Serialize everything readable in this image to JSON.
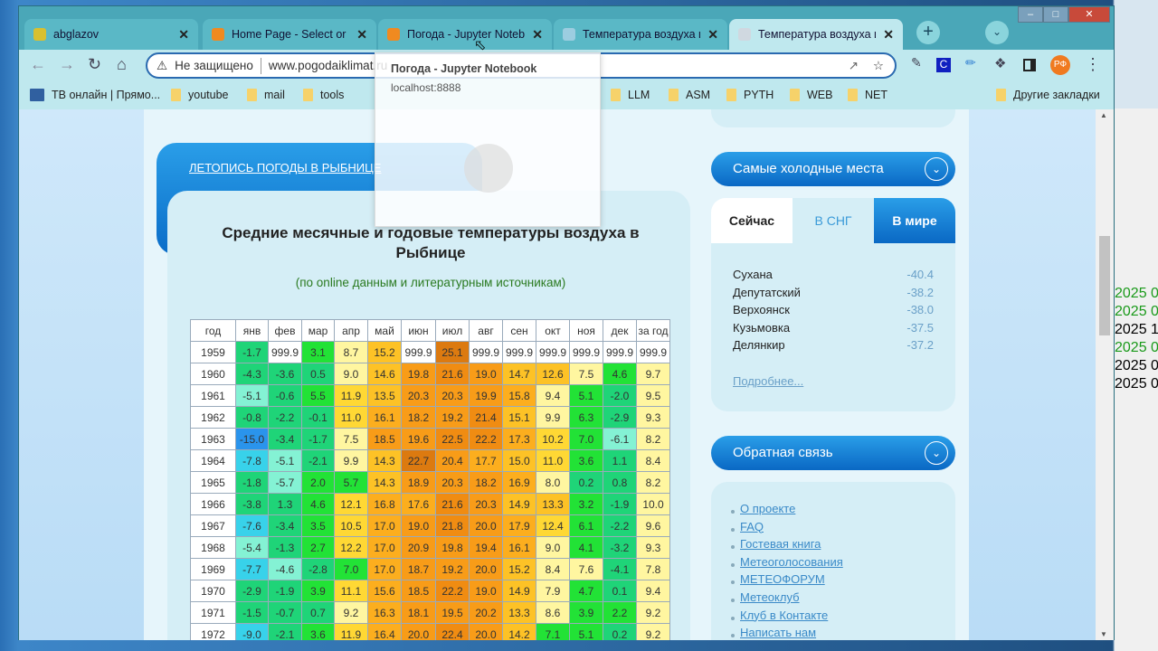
{
  "browser": {
    "tabs": [
      {
        "title": "abglazov",
        "favicon": "#d8c030",
        "active": false
      },
      {
        "title": "Home Page - Select or c",
        "favicon": "#f08a20",
        "active": false
      },
      {
        "title": "Погода - Jupyter Notebo",
        "favicon": "#f08a20",
        "active": false
      },
      {
        "title": "Температура воздуха и",
        "favicon": "#9ccde0",
        "active": false
      },
      {
        "title": "Температура воздуха и",
        "favicon": "#d0d8e0",
        "active": true
      }
    ],
    "security": "Не защищено",
    "url": "www.pogodaiklimat.ru",
    "profile": "РФ",
    "bookmarks": [
      "ТВ онлайн | Прямо...",
      "youtube",
      "mail",
      "tools",
      "LLM",
      "ASM",
      "PYTH",
      "WEB",
      "NET"
    ],
    "other_bookmarks": "Другие закладки",
    "tooltip": {
      "title": "Погода - Jupyter Notebook",
      "host": "localhost:8888"
    }
  },
  "page": {
    "header_link": "ЛЕТОПИСЬ ПОГОДЫ В РЫБНИЦЕ",
    "title": "Средние месячные и годовые температуры воздуха в Рыбнице",
    "subtitle": "(по online данным и литературным источникам)",
    "table": {
      "headers": [
        "год",
        "янв",
        "фев",
        "мар",
        "апр",
        "май",
        "июн",
        "июл",
        "авг",
        "сен",
        "окт",
        "ноя",
        "дек",
        "за год"
      ],
      "rows": [
        [
          "1959",
          "-1.7",
          "999.9",
          "3.1",
          "8.7",
          "15.2",
          "999.9",
          "25.1",
          "999.9",
          "999.9",
          "999.9",
          "999.9",
          "999.9",
          "999.9"
        ],
        [
          "1960",
          "-4.3",
          "-3.6",
          "0.5",
          "9.0",
          "14.6",
          "19.8",
          "21.6",
          "19.0",
          "14.7",
          "12.6",
          "7.5",
          "4.6",
          "9.7"
        ],
        [
          "1961",
          "-5.1",
          "-0.6",
          "5.5",
          "11.9",
          "13.5",
          "20.3",
          "20.3",
          "19.9",
          "15.8",
          "9.4",
          "5.1",
          "-2.0",
          "9.5"
        ],
        [
          "1962",
          "-0.8",
          "-2.2",
          "-0.1",
          "11.0",
          "16.1",
          "18.2",
          "19.2",
          "21.4",
          "15.1",
          "9.9",
          "6.3",
          "-2.9",
          "9.3"
        ],
        [
          "1963",
          "-15.0",
          "-3.4",
          "-1.7",
          "7.5",
          "18.5",
          "19.6",
          "22.5",
          "22.2",
          "17.3",
          "10.2",
          "7.0",
          "-6.1",
          "8.2"
        ],
        [
          "1964",
          "-7.8",
          "-5.1",
          "-2.1",
          "9.9",
          "14.3",
          "22.7",
          "20.4",
          "17.7",
          "15.0",
          "11.0",
          "3.6",
          "1.1",
          "8.4"
        ],
        [
          "1965",
          "-1.8",
          "-5.7",
          "2.0",
          "5.7",
          "14.3",
          "18.9",
          "20.3",
          "18.2",
          "16.9",
          "8.0",
          "0.2",
          "0.8",
          "8.2"
        ],
        [
          "1966",
          "-3.8",
          "1.3",
          "4.6",
          "12.1",
          "16.8",
          "17.6",
          "21.6",
          "20.3",
          "14.9",
          "13.3",
          "3.2",
          "-1.9",
          "10.0"
        ],
        [
          "1967",
          "-7.6",
          "-3.4",
          "3.5",
          "10.5",
          "17.0",
          "19.0",
          "21.8",
          "20.0",
          "17.9",
          "12.4",
          "6.1",
          "-2.2",
          "9.6"
        ],
        [
          "1968",
          "-5.4",
          "-1.3",
          "2.7",
          "12.2",
          "17.0",
          "20.9",
          "19.8",
          "19.4",
          "16.1",
          "9.0",
          "4.1",
          "-3.2",
          "9.3"
        ],
        [
          "1969",
          "-7.7",
          "-4.6",
          "-2.8",
          "7.0",
          "17.0",
          "18.7",
          "19.2",
          "20.0",
          "15.2",
          "8.4",
          "7.6",
          "-4.1",
          "7.8"
        ],
        [
          "1970",
          "-2.9",
          "-1.9",
          "3.9",
          "11.1",
          "15.6",
          "18.5",
          "22.2",
          "19.0",
          "14.9",
          "7.9",
          "4.7",
          "0.1",
          "9.4"
        ],
        [
          "1971",
          "-1.5",
          "-0.7",
          "0.7",
          "9.2",
          "16.3",
          "18.1",
          "19.5",
          "20.2",
          "13.3",
          "8.6",
          "3.9",
          "2.2",
          "9.2"
        ],
        [
          "1972",
          "-9.0",
          "-2.1",
          "3.6",
          "11.9",
          "16.4",
          "20.0",
          "22.4",
          "20.0",
          "14.2",
          "7.1",
          "5.1",
          "0.2",
          "9.2"
        ]
      ]
    }
  },
  "sidebar": {
    "cold_title": "Самые холодные места",
    "cold_tabs": [
      "Сейчас",
      "В СНГ",
      "В мире"
    ],
    "cold_places": [
      {
        "name": "Сухана",
        "temp": "-40.4"
      },
      {
        "name": "Депутатский",
        "temp": "-38.2"
      },
      {
        "name": "Верхоянск",
        "temp": "-38.0"
      },
      {
        "name": "Кузьмовка",
        "temp": "-37.5"
      },
      {
        "name": "Делянкир",
        "temp": "-37.2"
      }
    ],
    "more": "Подробнее...",
    "feedback_title": "Обратная связь",
    "links": [
      "О проекте",
      "FAQ",
      "Гостевая книга",
      "Метеоголосования",
      "МЕТЕОФОРУМ",
      "Метеоклуб",
      "Клуб в Контакте",
      "Написать нам"
    ]
  },
  "desktop": {
    "right_lines": [
      "2025 0",
      "2025 0",
      "2025 1",
      "2025 0",
      "2025 0",
      "2025 0"
    ]
  }
}
